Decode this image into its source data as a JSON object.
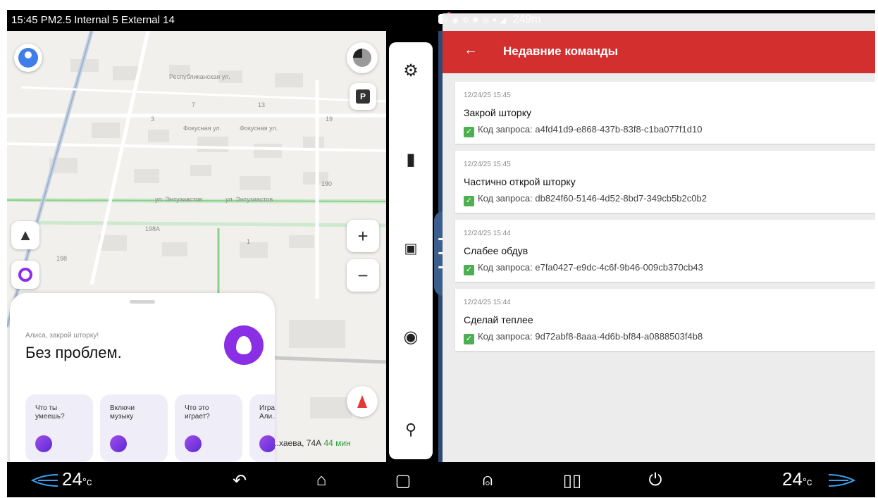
{
  "status_bar": {
    "left_text": "15:45 PM2.5 Internal 5 External 14",
    "right_text": "249m",
    "right_icons": "⚲ ◉ ⟲ ✱ ◎ ▾ ◢"
  },
  "map": {
    "labels": [
      "ул. Энтузиастов",
      "ул. Энтузиастов",
      "Фокусная ул.",
      "Фокусная ул.",
      "Республиканская ул.",
      "198А",
      "190",
      "13",
      "19",
      "7",
      "3",
      "1",
      "198"
    ],
    "eta_address": "...хаева, 74А",
    "eta_time": "44 мин",
    "zoom_in_label": "+",
    "zoom_out_label": "−",
    "parking_label": "P"
  },
  "alice": {
    "query": "Алиса, закрой шторку!",
    "answer": "Без проблем.",
    "suggestions": [
      {
        "label": "Что ты умеешь?"
      },
      {
        "label": "Включи музыку"
      },
      {
        "label": "Что это играет?"
      },
      {
        "label": "Игра Али..."
      }
    ]
  },
  "toolbar": {
    "icons": [
      "gear-icon",
      "bookmark-icon",
      "screen-cast-icon",
      "music-icon",
      "search-icon"
    ]
  },
  "recent": {
    "title": "Недавние команды",
    "back_glyph": "←",
    "items": [
      {
        "time": "12/24/25 15:45",
        "command": "Закрой шторку",
        "request": "Код запроса: a4fd41d9-e868-437b-83f8-c1ba077f1d10"
      },
      {
        "time": "12/24/25 15:45",
        "command": "Частично открой шторку",
        "request": "Код запроса: db824f60-5146-4d52-8bd7-349cb5b2c0b2"
      },
      {
        "time": "12/24/25 15:44",
        "command": "Слабее обдув",
        "request": "Код запроса: e7fa0427-e9dc-4c6f-9b46-009cb370cb43"
      },
      {
        "time": "12/24/25 15:44",
        "command": "Сделай теплее",
        "request": "Код запроса: 9d72abf8-8aaa-4d6b-bf84-a0888503f4b8"
      }
    ]
  },
  "bottom_bar": {
    "temp_left": "24",
    "temp_right": "24",
    "temp_unit": "°c"
  },
  "colors": {
    "accent_red": "#d32f2f",
    "alice_purple": "#8b2fe6",
    "divider_blue": "#2d4a73",
    "check_green": "#4caf50"
  }
}
